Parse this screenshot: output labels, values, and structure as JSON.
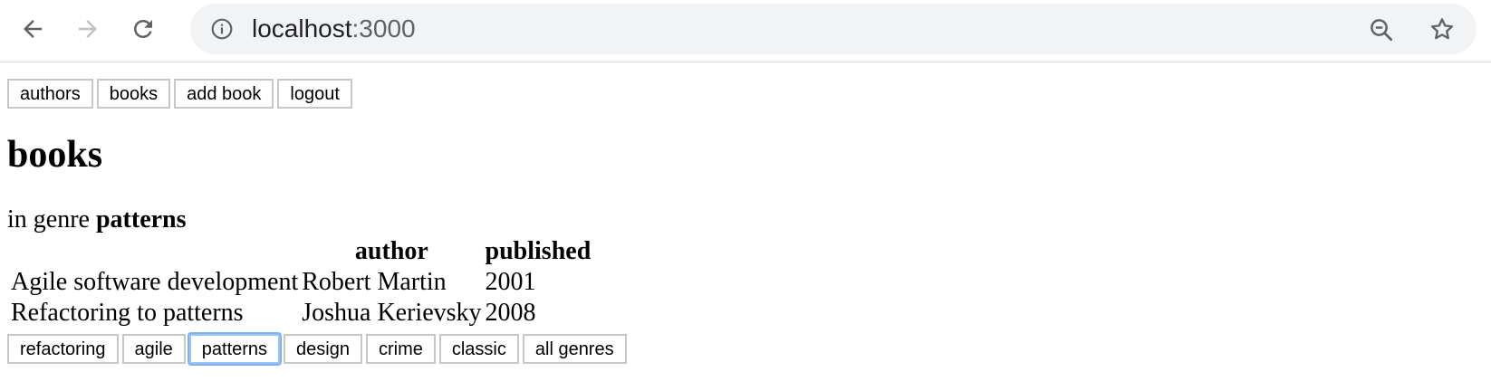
{
  "browser": {
    "url_host": "localhost",
    "url_port": ":3000",
    "icons": [
      "back-icon",
      "forward-icon",
      "reload-icon",
      "info-icon",
      "zoom-out-icon",
      "bookmark-star-icon"
    ]
  },
  "menu": {
    "authors": "authors",
    "books": "books",
    "add_book": "add book",
    "logout": "logout"
  },
  "page": {
    "title": "books",
    "genre_prefix": "in genre",
    "genre": "patterns"
  },
  "table": {
    "headers": [
      "",
      "author",
      "published"
    ],
    "rows": [
      {
        "title": "Agile software development",
        "author": "Robert Martin",
        "published": "2001"
      },
      {
        "title": "Refactoring to patterns",
        "author": "Joshua Kerievsky",
        "published": "2008"
      }
    ]
  },
  "genres": {
    "items": [
      "refactoring",
      "agile",
      "patterns",
      "design",
      "crime",
      "classic",
      "all genres"
    ],
    "selected": "patterns"
  }
}
